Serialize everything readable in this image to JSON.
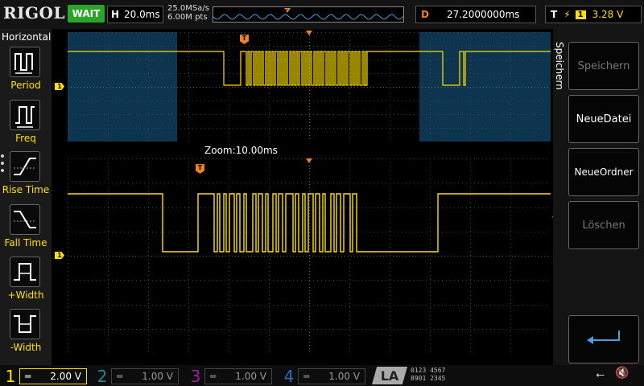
{
  "header": {
    "brand": "RIGOL",
    "status": "WAIT",
    "timebase_letter": "H",
    "timebase": "20.0ms",
    "sample_rate": "25.0MSa/s",
    "memory_depth": "6.00M pts",
    "delay_letter": "D",
    "delay": "27.2000000ms",
    "trigger_letter": "T",
    "trigger_slope": "⚡",
    "trigger_channel": "1",
    "trigger_level": "3.28 V"
  },
  "measure_panel": {
    "title": "Horizontal",
    "items": [
      {
        "label": "Period",
        "icon": "period-icon"
      },
      {
        "label": "Freq",
        "icon": "freq-icon"
      },
      {
        "label": "Rise Time",
        "icon": "rise-time-icon"
      },
      {
        "label": "Fall Time",
        "icon": "fall-time-icon"
      },
      {
        "label": "+Width",
        "icon": "positive-width-icon"
      },
      {
        "label": "-Width",
        "icon": "negative-width-icon"
      }
    ]
  },
  "menu": {
    "title": "Speichern",
    "softkeys": [
      {
        "label": "Speichern",
        "enabled": false
      },
      {
        "label": "NeueDatei",
        "enabled": true
      },
      {
        "label": "NeueOrdner",
        "enabled": true
      },
      {
        "label": "Löschen",
        "enabled": false
      }
    ],
    "enter_icon": "enter-arrow-icon"
  },
  "display": {
    "zoom_label": "Zoom:10.00ms",
    "channel_marker": "1",
    "trigger_marker": "T",
    "trace_color": "#ffe000",
    "overview_highlight_color": "#0d3550"
  },
  "channels": [
    {
      "num": "1",
      "coupling": "═",
      "scale": "2.00 V",
      "color": "#ffe000"
    },
    {
      "num": "2",
      "coupling": "═",
      "scale": "1.00 V",
      "color": "#1e8a8a"
    },
    {
      "num": "3",
      "coupling": "═",
      "scale": "1.00 V",
      "color": "#a01ea0"
    },
    {
      "num": "4",
      "coupling": "═",
      "scale": "1.00 V",
      "color": "#2a6ac0"
    }
  ],
  "la": {
    "label": "LA",
    "row1": "0123 4567",
    "row2": "8901 2345"
  },
  "status_icons": [
    "usb-icon",
    "speaker-muted-icon"
  ]
}
